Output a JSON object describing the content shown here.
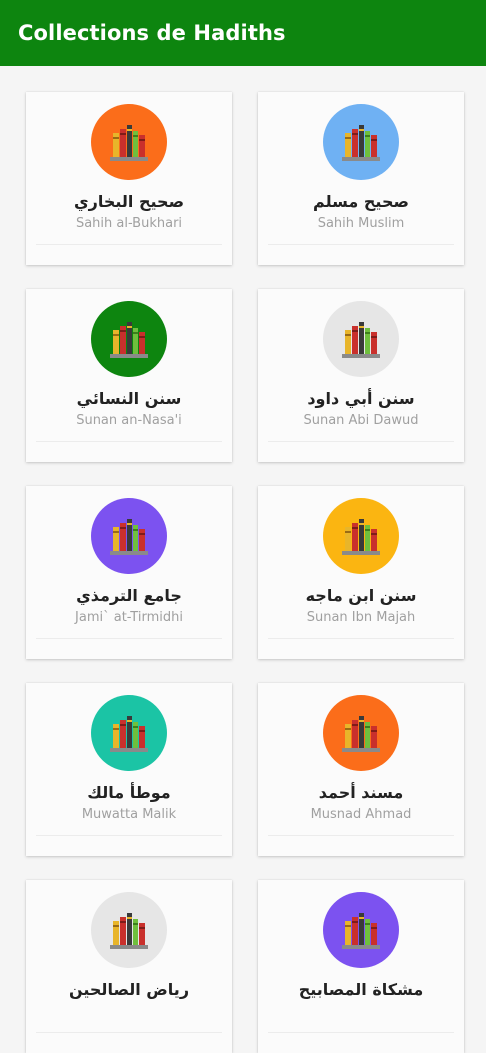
{
  "appbar": {
    "title": "Collections de Hadiths",
    "color": "#0d850f"
  },
  "collections": [
    {
      "ar": "صحيح البخاري",
      "en": "Sahih al-Bukhari",
      "color": "#fb6d1a"
    },
    {
      "ar": "صحيح مسلم",
      "en": "Sahih Muslim",
      "color": "#6fb1f3"
    },
    {
      "ar": "سنن النسائي",
      "en": "Sunan an-Nasa'i",
      "color": "#0d850f"
    },
    {
      "ar": "سنن أبي داود",
      "en": "Sunan Abi Dawud",
      "color": "#e6e6e6"
    },
    {
      "ar": "جامع الترمذي",
      "en": "Jami` at-Tirmidhi",
      "color": "#7c52f0"
    },
    {
      "ar": "سنن ابن ماجه",
      "en": "Sunan Ibn Majah",
      "color": "#fbb511"
    },
    {
      "ar": "موطأ مالك",
      "en": "Muwatta Malik",
      "color": "#1bc4a5"
    },
    {
      "ar": "مسند أحمد",
      "en": "Musnad Ahmad",
      "color": "#fb6d1a"
    },
    {
      "ar": "رياض الصالحين",
      "en": "",
      "color": "#e6e6e6"
    },
    {
      "ar": "مشكاة المصابيح",
      "en": "",
      "color": "#7c52f0"
    }
  ],
  "icons": {
    "collection": "books-icon"
  }
}
